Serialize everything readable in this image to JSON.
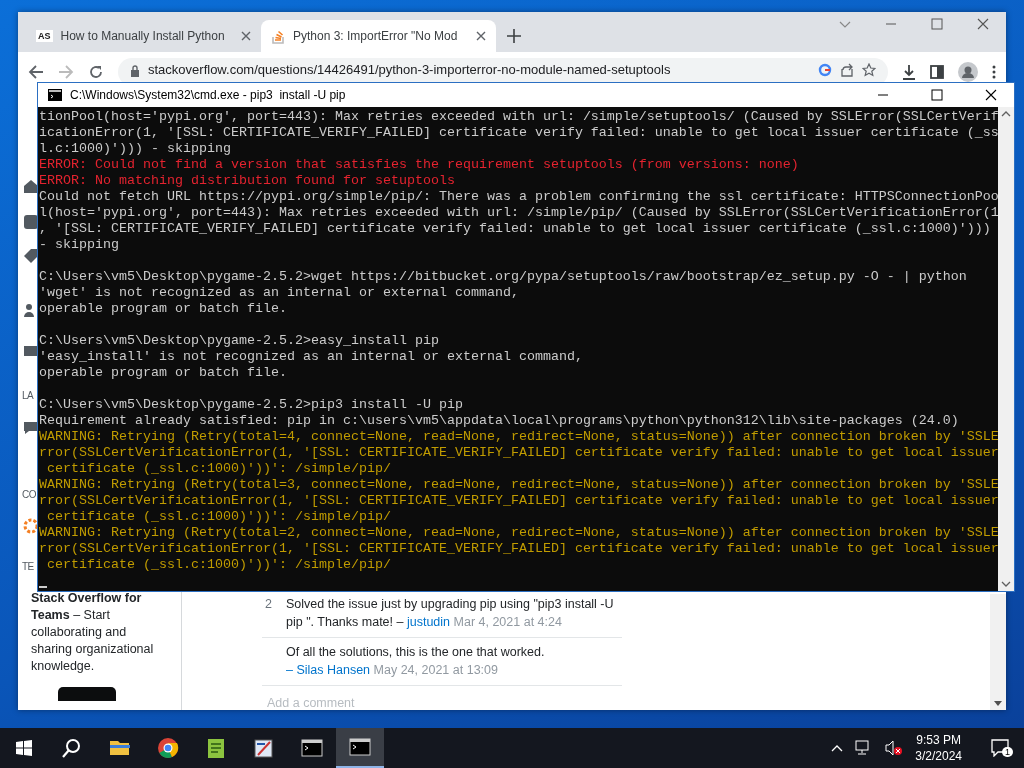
{
  "browser": {
    "tabs": [
      {
        "favicon_text": "AS",
        "label": "How to Manually Install Python",
        "selected": false
      },
      {
        "label": "Python 3: ImportError \"No Mod",
        "selected": true
      }
    ],
    "url": "stackoverflow.com/questions/14426491/python-3-importerror-no-module-named-setuptools",
    "sidebar": {
      "labels": [
        "LA",
        "CO",
        "TE"
      ],
      "teams_card": "**Stack Overflow for Teams** – Start collaborating and sharing organizational knowledge."
    },
    "comments": [
      {
        "votes": "2",
        "text": "Solved the issue just by upgrading pip using \"pip3 install -U pip \". Thanks mate! –",
        "user": "justudin",
        "date": "Mar 4, 2021 at 4:24"
      },
      {
        "text": "Of all the solutions, this is the one that worked.",
        "user": "– Silas Hansen",
        "date": "May 24, 2021 at 13:09"
      }
    ],
    "add_comment": "Add a comment"
  },
  "cmd": {
    "title": "C:\\Windows\\System32\\cmd.exe - pip3  install -U pip",
    "lines": [
      {
        "kind": "normal",
        "text": "tionPool(host='pypi.org', port=443): Max retries exceeded with url: /simple/setuptools/ (Caused by SSLError(SSLCertVerif"
      },
      {
        "kind": "normal",
        "text": "icationError(1, '[SSL: CERTIFICATE_VERIFY_FAILED] certificate verify failed: unable to get local issuer certificate (_ss"
      },
      {
        "kind": "normal",
        "text": "l.c:1000)'))) - skipping"
      },
      {
        "kind": "error",
        "text": "ERROR: Could not find a version that satisfies the requirement setuptools (from versions: none)"
      },
      {
        "kind": "error",
        "text": "ERROR: No matching distribution found for setuptools"
      },
      {
        "kind": "normal",
        "text": "Could not fetch URL https://pypi.org/simple/pip/: There was a problem confirming the ssl certificate: HTTPSConnectionPoo"
      },
      {
        "kind": "normal",
        "text": "l(host='pypi.org', port=443): Max retries exceeded with url: /simple/pip/ (Caused by SSLError(SSLCertVerificationError(1"
      },
      {
        "kind": "normal",
        "text": ", '[SSL: CERTIFICATE_VERIFY_FAILED] certificate verify failed: unable to get local issuer certificate (_ssl.c:1000)')))"
      },
      {
        "kind": "normal",
        "text": "- skipping"
      },
      {
        "kind": "blank"
      },
      {
        "kind": "normal",
        "text": "C:\\Users\\vm5\\Desktop\\pygame-2.5.2>wget https://bitbucket.org/pypa/setuptools/raw/bootstrap/ez_setup.py -O - | python"
      },
      {
        "kind": "normal",
        "text": "'wget' is not recognized as an internal or external command,"
      },
      {
        "kind": "normal",
        "text": "operable program or batch file."
      },
      {
        "kind": "blank"
      },
      {
        "kind": "normal",
        "text": "C:\\Users\\vm5\\Desktop\\pygame-2.5.2>easy_install pip"
      },
      {
        "kind": "normal",
        "text": "'easy_install' is not recognized as an internal or external command,"
      },
      {
        "kind": "normal",
        "text": "operable program or batch file."
      },
      {
        "kind": "blank"
      },
      {
        "kind": "normal",
        "text": "C:\\Users\\vm5\\Desktop\\pygame-2.5.2>pip3 install -U pip"
      },
      {
        "kind": "normal",
        "text": "Requirement already satisfied: pip in c:\\users\\vm5\\appdata\\local\\programs\\python\\python312\\lib\\site-packages (24.0)"
      },
      {
        "kind": "warning",
        "text": "WARNING: Retrying (Retry(total=4, connect=None, read=None, redirect=None, status=None)) after connection broken by 'SSLE"
      },
      {
        "kind": "warning",
        "text": "rror(SSLCertVerificationError(1, '[SSL: CERTIFICATE_VERIFY_FAILED] certificate verify failed: unable to get local issuer"
      },
      {
        "kind": "warning",
        "text": " certificate (_ssl.c:1000)'))': /simple/pip/"
      },
      {
        "kind": "warning",
        "text": "WARNING: Retrying (Retry(total=3, connect=None, read=None, redirect=None, status=None)) after connection broken by 'SSLE"
      },
      {
        "kind": "warning",
        "text": "rror(SSLCertVerificationError(1, '[SSL: CERTIFICATE_VERIFY_FAILED] certificate verify failed: unable to get local issuer"
      },
      {
        "kind": "warning",
        "text": " certificate (_ssl.c:1000)'))': /simple/pip/"
      },
      {
        "kind": "warning",
        "text": "WARNING: Retrying (Retry(total=2, connect=None, read=None, redirect=None, status=None)) after connection broken by 'SSLE"
      },
      {
        "kind": "warning",
        "text": "rror(SSLCertVerificationError(1, '[SSL: CERTIFICATE_VERIFY_FAILED] certificate verify failed: unable to get local issuer"
      },
      {
        "kind": "warning",
        "text": " certificate (_ssl.c:1000)'))': /simple/pip/"
      },
      {
        "kind": "cursor"
      }
    ]
  },
  "taskbar": {
    "apps": [
      {
        "kind": "explorer",
        "active": false
      },
      {
        "kind": "chrome",
        "active": false
      },
      {
        "kind": "notepad",
        "active": false
      },
      {
        "kind": "paint",
        "active": false
      },
      {
        "kind": "terminal",
        "active": false
      },
      {
        "kind": "terminal",
        "active": true
      }
    ],
    "time": "9:53 PM",
    "date": "3/2/2024",
    "notifications": "1"
  }
}
